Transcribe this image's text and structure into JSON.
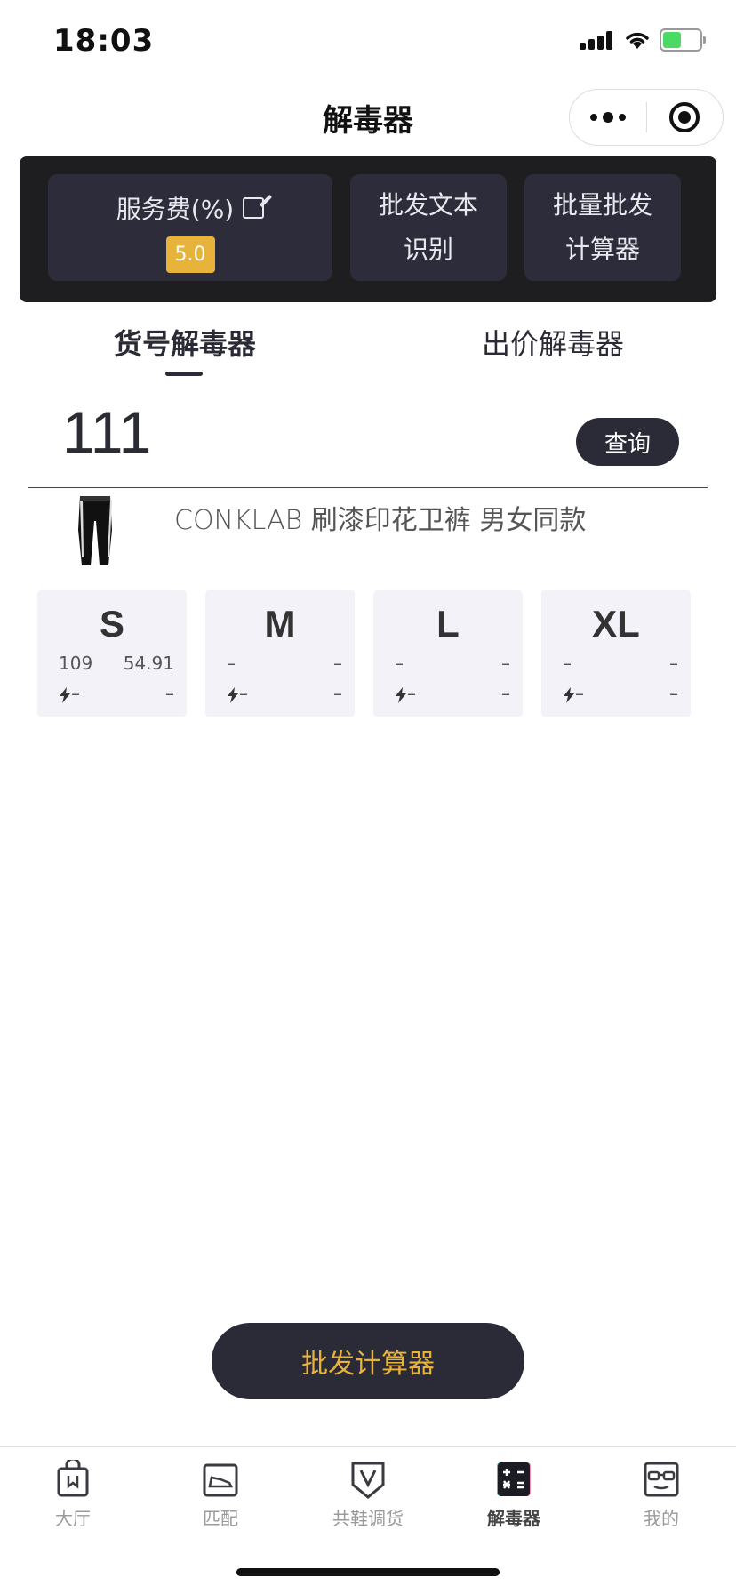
{
  "status_bar": {
    "time": "18:03"
  },
  "nav": {
    "title": "解毒器"
  },
  "tools": {
    "fee_label": "服务费(%)",
    "fee_value": "5.0",
    "ocr_line1": "批发文本",
    "ocr_line2": "识别",
    "calc_line1": "批量批发",
    "calc_line2": "计算器"
  },
  "tabs": {
    "active": "货号解毒器",
    "inactive": "出价解毒器"
  },
  "query": {
    "value": "111",
    "button": "查询"
  },
  "product": {
    "name": "CONKLAB 刷漆印花卫裤 男女同款"
  },
  "sizes": [
    {
      "label": "S",
      "r1_left": "109",
      "r1_right": "54.91",
      "r2_left": "–",
      "r2_right": "–"
    },
    {
      "label": "M",
      "r1_left": "–",
      "r1_right": "–",
      "r2_left": "–",
      "r2_right": "–"
    },
    {
      "label": "L",
      "r1_left": "–",
      "r1_right": "–",
      "r2_left": "–",
      "r2_right": "–"
    },
    {
      "label": "XL",
      "r1_left": "–",
      "r1_right": "–",
      "r2_left": "–",
      "r2_right": "–"
    }
  ],
  "calc_button": "批发计算器",
  "tabbar": [
    {
      "label": "大厅",
      "icon": "shopping-bag-icon"
    },
    {
      "label": "匹配",
      "icon": "shoe-box-icon"
    },
    {
      "label": "共鞋调货",
      "icon": "v-shield-icon"
    },
    {
      "label": "解毒器",
      "icon": "calculator-icon",
      "active": true
    },
    {
      "label": "我的",
      "icon": "glasses-face-icon"
    }
  ],
  "colors": {
    "accent": "#e8b33a",
    "dark": "#2b2b38",
    "panel": "#1e1e20"
  }
}
